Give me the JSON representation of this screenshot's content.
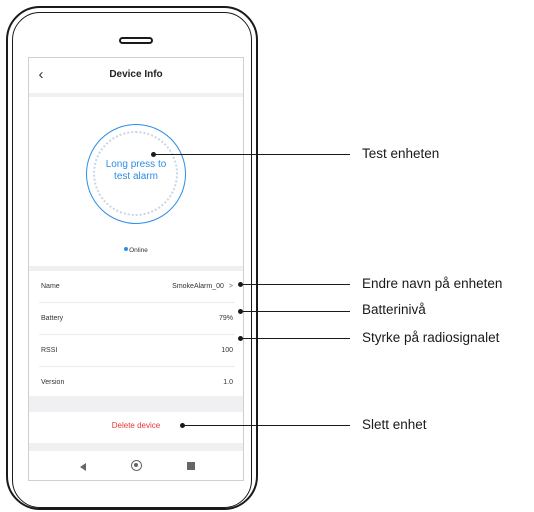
{
  "header": {
    "back_glyph": "‹",
    "title": "Device Info"
  },
  "alarm": {
    "line1": "Long press to",
    "line2": "test alarm"
  },
  "status": {
    "text": "Online"
  },
  "rows": [
    {
      "label": "Name",
      "value": "SmokeAlarm_00",
      "chevron": ">"
    },
    {
      "label": "Battery",
      "value": "79%"
    },
    {
      "label": "RSSI",
      "value": "100"
    },
    {
      "label": "Version",
      "value": "1.0"
    }
  ],
  "delete_label": "Delete device",
  "callouts": {
    "test": "Test enheten",
    "rename": "Endre navn på enheten",
    "battery": "Batterinivå",
    "signal": "Styrke på radiosignalet",
    "delete": "Slett enhet"
  },
  "colors": {
    "accent": "#2c8de6",
    "danger": "#e53935"
  }
}
